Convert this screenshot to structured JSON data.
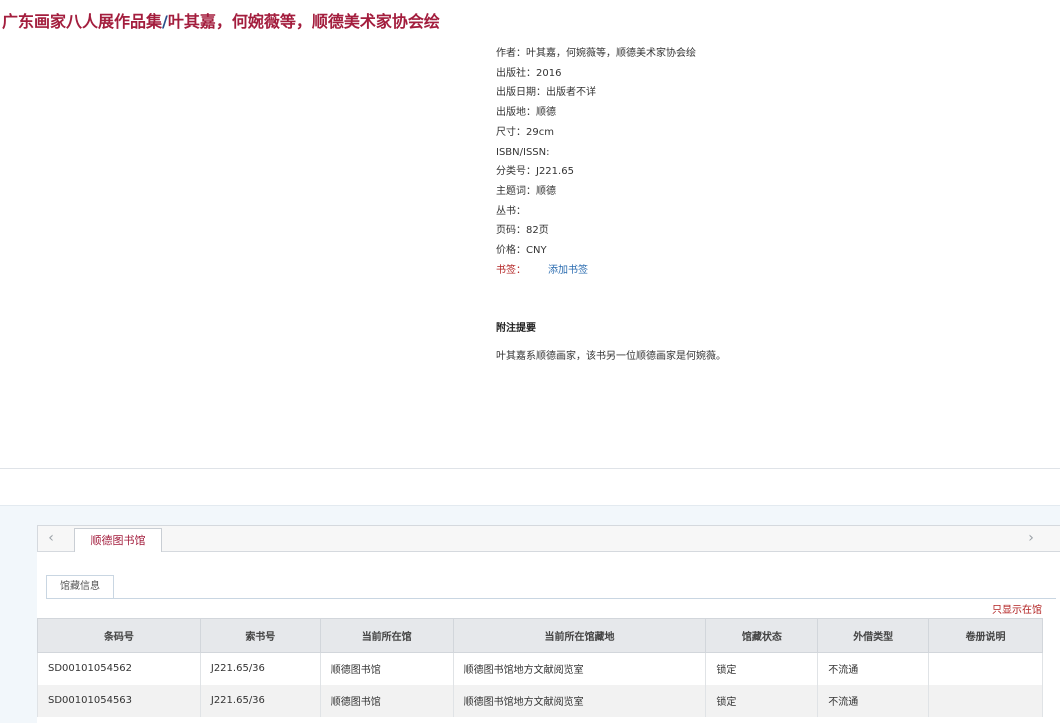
{
  "record": {
    "title_main": "广东画家八人展作品集",
    "title_sep": "/",
    "title_resp": "叶其嘉，何婉薇等，顺德美术家协会绘"
  },
  "meta": {
    "author": "作者：叶其嘉，何婉薇等，顺德美术家协会绘",
    "publisher": "出版社：2016",
    "pub_date": "出版日期：出版者不详",
    "pub_place": "出版地：顺德",
    "size": "尺寸：29cm",
    "isbn": "ISBN/ISSN:",
    "classification": "分类号：J221.65",
    "subject": "主题词：顺德",
    "series": "丛书：",
    "pages": "页码：82页",
    "price": "价格：CNY",
    "bookmark_label": "书签：",
    "bookmark_link": "添加书签"
  },
  "notes": {
    "title": "附注提要",
    "text": "叶其嘉系顺德画家，该书另一位顺德画家是何婉薇。"
  },
  "tabs": {
    "left_arrow": "‹",
    "right_arrow": "›",
    "library": "顺德图书馆",
    "holdings_info": "馆藏信息",
    "only_show": "只显示在馆"
  },
  "table": {
    "headers": [
      "条码号",
      "索书号",
      "当前所在馆",
      "当前所在馆藏地",
      "馆藏状态",
      "外借类型",
      "卷册说明"
    ],
    "rows": [
      [
        "SD00101054562",
        "J221.65/36",
        "顺德图书馆",
        "顺德图书馆地方文献阅览室",
        "锁定",
        "不流通",
        ""
      ],
      [
        "SD00101054563",
        "J221.65/36",
        "顺德图书馆",
        "顺德图书馆地方文献阅览室",
        "锁定",
        "不流通",
        ""
      ]
    ]
  }
}
